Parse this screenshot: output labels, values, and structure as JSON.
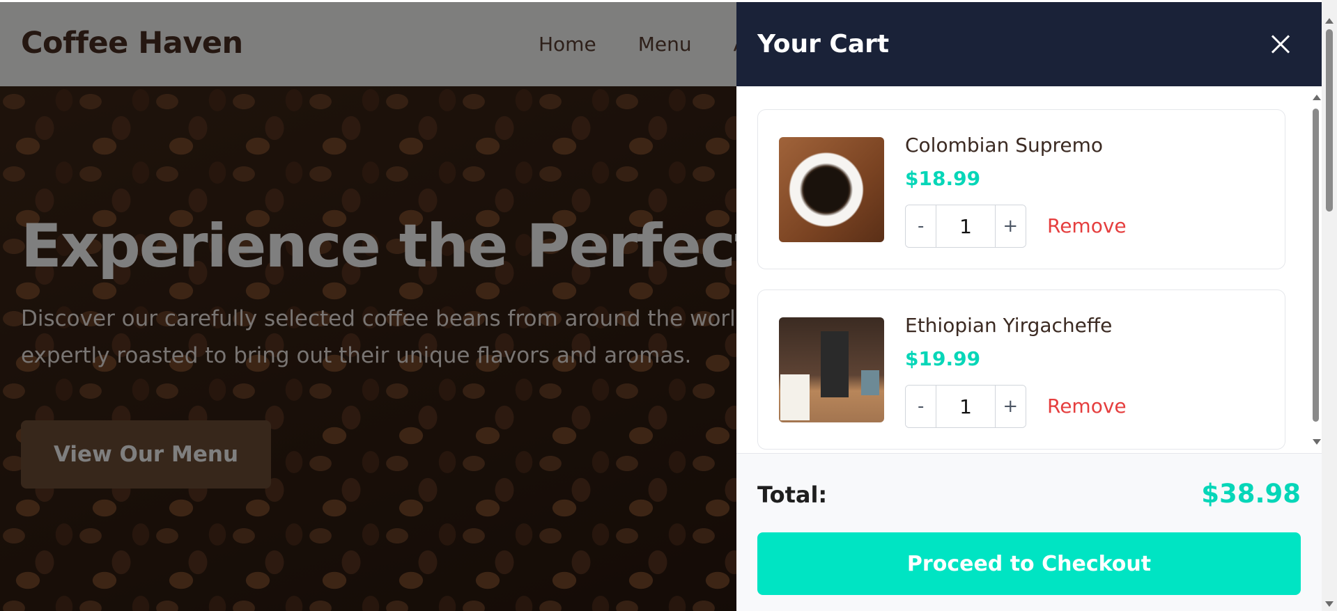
{
  "site": {
    "brand": "Coffee Haven",
    "nav": [
      "Home",
      "Menu",
      "A"
    ]
  },
  "hero": {
    "title": "Experience the Perfect Cup",
    "text": "Discover our carefully selected coffee beans from around the world, expertly roasted to bring out their unique flavors and aromas.",
    "cta_label": "View Our Menu"
  },
  "cart": {
    "title": "Your Cart",
    "close_icon": "close-icon",
    "items": [
      {
        "name": "Colombian Supremo",
        "price": "$18.99",
        "quantity": "1",
        "decrement_label": "-",
        "increment_label": "+",
        "remove_label": "Remove",
        "image": "coffee-cup-image"
      },
      {
        "name": "Ethiopian Yirgacheffe",
        "price": "$19.99",
        "quantity": "1",
        "decrement_label": "-",
        "increment_label": "+",
        "remove_label": "Remove",
        "image": "coffee-grinder-image"
      }
    ],
    "total_label": "Total:",
    "total_value": "$38.98",
    "checkout_label": "Proceed to Checkout"
  },
  "colors": {
    "accent": "#00e4c3",
    "cart_header": "#1a2238",
    "remove": "#e53e3e",
    "brand": "#4a2e22"
  }
}
